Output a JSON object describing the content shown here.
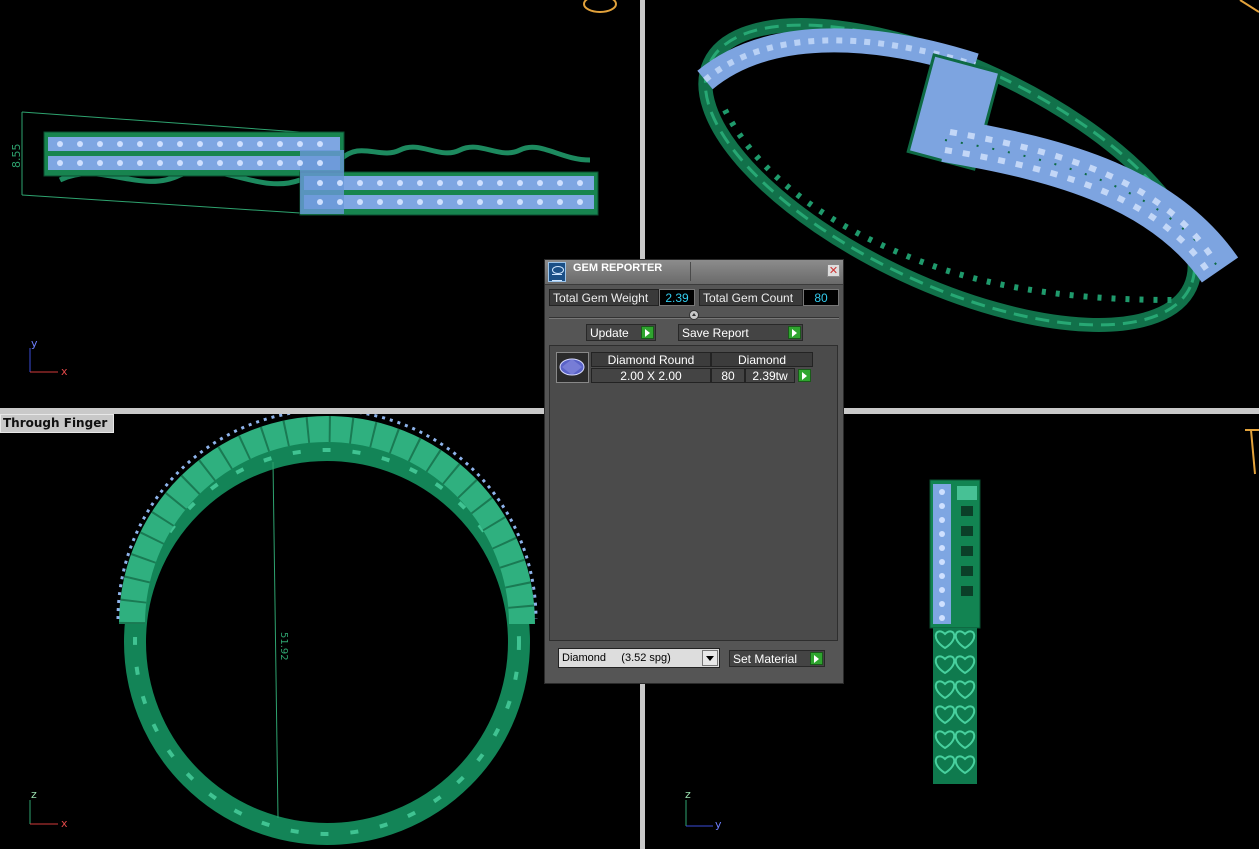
{
  "viewports": {
    "bottom_left": {
      "label": "Through Finger",
      "dimension": "51.92",
      "axis_up": "z",
      "axis_right": "x"
    },
    "top_left": {
      "dimension": "8.55",
      "axis_up": "y",
      "axis_right": "x"
    },
    "bottom_right": {
      "axis_up": "z",
      "axis_right": "y"
    }
  },
  "gem_reporter": {
    "title": "GEM REPORTER",
    "close_glyph": "✕",
    "total_gem_weight_label": "Total Gem Weight",
    "total_gem_weight": "2.39",
    "total_gem_count_label": "Total Gem Count",
    "total_gem_count": "80",
    "update_label": "Update",
    "save_report_label": "Save Report",
    "table": {
      "headers": [
        "Diamond Round",
        "Diamond"
      ],
      "rows": [
        {
          "size": "2.00 X 2.00",
          "count": "80",
          "weight": "2.39tw"
        }
      ]
    },
    "material_select": "Diamond     (3.52 spg)",
    "set_material_label": "Set Material"
  },
  "colors": {
    "metal_green": "#1f9a6c",
    "metal_dark": "#0d5a3d",
    "gem_blue": "#8eb4ec",
    "divider": "#c9c9c9"
  }
}
